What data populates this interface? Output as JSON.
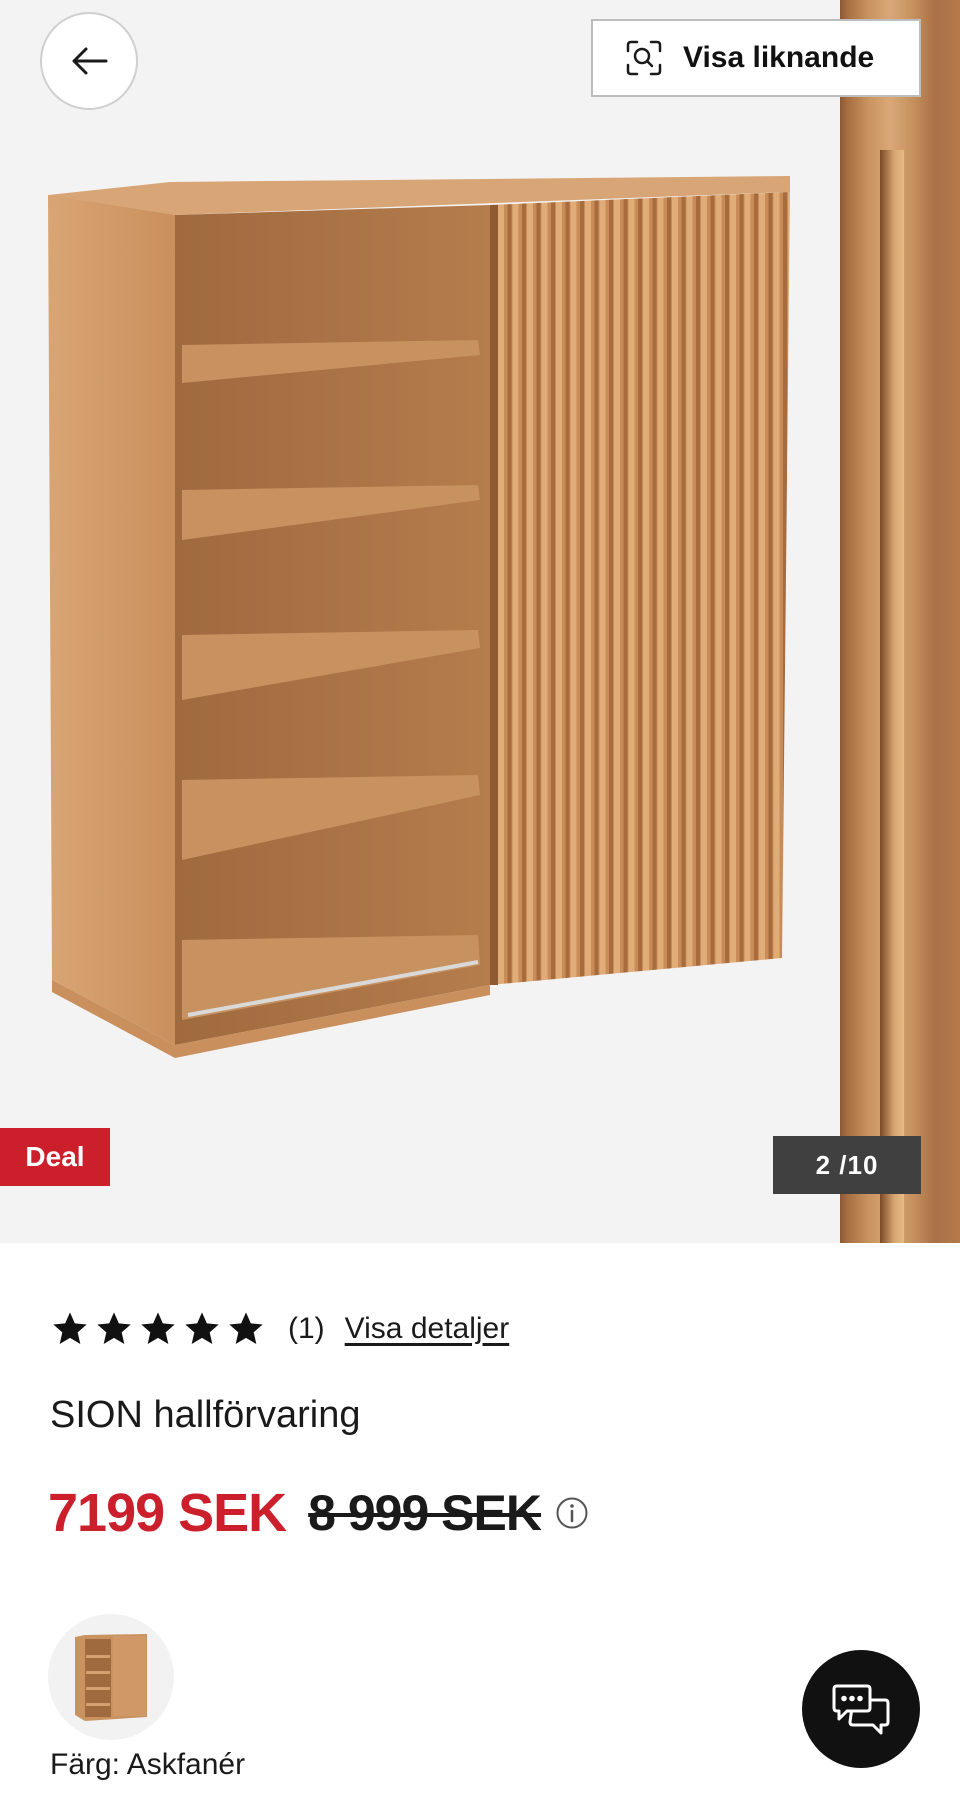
{
  "gallery": {
    "similar_label": "Visa liknande",
    "deal_badge": "Deal",
    "counter": "2 /10"
  },
  "product": {
    "rating_stars": 5,
    "review_count": "(1)",
    "details_link": "Visa detaljer",
    "name": "SION hallförvaring",
    "price_current": "7199 SEK",
    "price_old": "8 999 SEK",
    "color_label": "Färg: Askfanér"
  },
  "colors": {
    "accent_red": "#cc1f2c",
    "wood": "#c8935f",
    "counter_bg": "#404040",
    "chat_bg": "#111111"
  },
  "icons": {
    "back": "arrow-left-icon",
    "similar": "visual-search-icon",
    "star": "star-icon",
    "info": "info-icon",
    "chat": "chat-icon"
  }
}
